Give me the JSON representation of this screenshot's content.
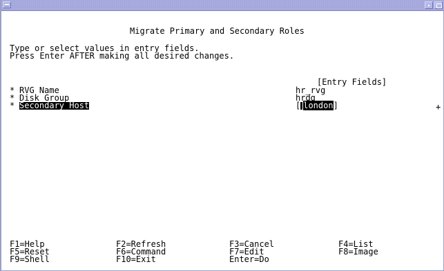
{
  "screen": {
    "title": "Migrate Primary and Secondary Roles",
    "instructions": [
      "Type or select values in entry fields.",
      "Press Enter AFTER making all desired changes."
    ],
    "entry_fields_header": "[Entry Fields]",
    "fields": [
      {
        "marker": "*",
        "label": "RVG Name",
        "value": "hr_rvg"
      },
      {
        "marker": "*",
        "label": "Disk Group",
        "value": "hrdg"
      },
      {
        "marker": "*",
        "label": "Secondary Host",
        "value_open": "[",
        "value": "london",
        "value_close": "]",
        "list_indicator": "+"
      }
    ],
    "function_keys": [
      [
        "F1=Help",
        "F2=Refresh",
        "F3=Cancel",
        "F4=List"
      ],
      [
        "F5=Reset",
        "F6=Command",
        "F7=Edit",
        "F8=Image"
      ],
      [
        "F9=Shell",
        "F10=Exit",
        "Enter=Do"
      ]
    ]
  },
  "colors": {
    "titlebar": "#a9ade0",
    "text": "#000000",
    "background": "#ffffff",
    "highlight": "#000000"
  }
}
